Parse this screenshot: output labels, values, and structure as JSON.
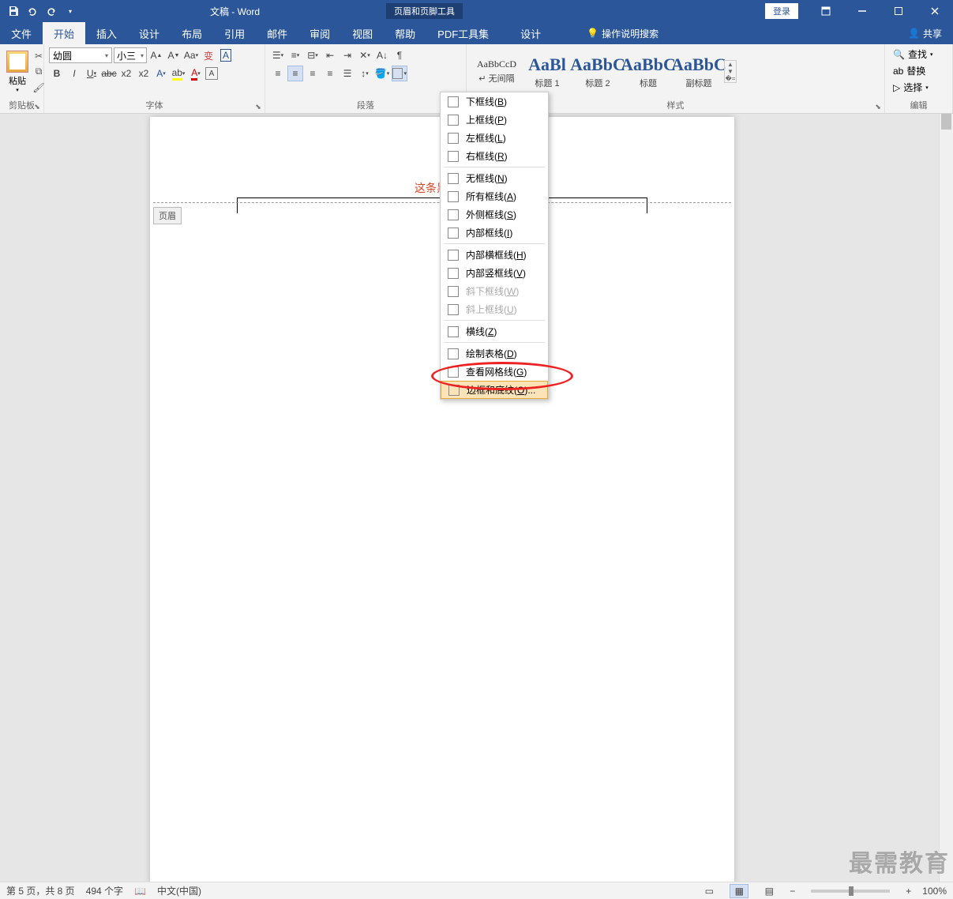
{
  "title": "文稿 - Word",
  "context_tool": "页眉和页脚工具",
  "login": "登录",
  "tabs": {
    "file": "文件",
    "home": "开始",
    "insert": "插入",
    "design": "设计",
    "layout": "布局",
    "references": "引用",
    "mail": "邮件",
    "review": "审阅",
    "view": "视图",
    "help": "帮助",
    "pdf": "PDF工具集",
    "ctx_design": "设计",
    "tellme": "操作说明搜索"
  },
  "share": "共享",
  "ribbon": {
    "paste": "粘贴",
    "font_name": "幼圆",
    "font_size": "小三",
    "group_clipboard": "剪贴板",
    "group_font": "字体",
    "group_para": "段落",
    "group_styles": "样式",
    "group_edit": "编辑",
    "styles": [
      {
        "preview": "AaBbCcD",
        "name": "↵ 无间隔",
        "cls": ""
      },
      {
        "preview": "AaBl",
        "name": "标题 1",
        "cls": "big"
      },
      {
        "preview": "AaBbC",
        "name": "标题 2",
        "cls": "big"
      },
      {
        "preview": "AaBbC",
        "name": "标题",
        "cls": "big"
      },
      {
        "preview": "AaBbC",
        "name": "副标题",
        "cls": "big"
      }
    ],
    "find": "查找",
    "replace": "替换",
    "select": "选择"
  },
  "doc": {
    "header_text": "这条黑线是",
    "header_tag": "页眉"
  },
  "border_menu": [
    {
      "label": "下框线",
      "key": "B"
    },
    {
      "label": "上框线",
      "key": "P"
    },
    {
      "label": "左框线",
      "key": "L"
    },
    {
      "label": "右框线",
      "key": "R"
    },
    {
      "sep": true
    },
    {
      "label": "无框线",
      "key": "N"
    },
    {
      "label": "所有框线",
      "key": "A"
    },
    {
      "label": "外侧框线",
      "key": "S"
    },
    {
      "label": "内部框线",
      "key": "I"
    },
    {
      "sep": true
    },
    {
      "label": "内部横框线",
      "key": "H"
    },
    {
      "label": "内部竖框线",
      "key": "V"
    },
    {
      "label": "斜下框线",
      "key": "W",
      "disabled": true
    },
    {
      "label": "斜上框线",
      "key": "U",
      "disabled": true
    },
    {
      "sep": true
    },
    {
      "label": "横线",
      "key": "Z"
    },
    {
      "sep": true
    },
    {
      "label": "绘制表格",
      "key": "D"
    },
    {
      "label": "查看网格线",
      "key": "G"
    },
    {
      "label": "边框和底纹",
      "key": "O",
      "highlight": true,
      "ellipsis": true
    }
  ],
  "status": {
    "page": "第 5 页，共 8 页",
    "words": "494 个字",
    "lang": "中文(中国)",
    "zoom": "100%"
  },
  "watermark": "最需教育"
}
